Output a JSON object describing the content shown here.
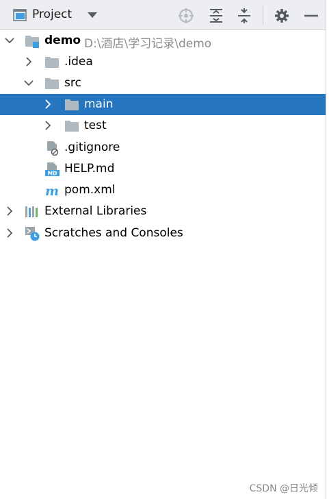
{
  "toolbar": {
    "title": "Project",
    "buttons": [
      "locate-icon",
      "expand-all-icon",
      "collapse-all-icon",
      "gear-icon",
      "minimize-icon"
    ]
  },
  "tree": {
    "root": {
      "label": "demo",
      "path": "D:\\酒店\\学习记录\\demo"
    },
    "idea": {
      "label": ".idea"
    },
    "src": {
      "label": "src"
    },
    "main": {
      "label": "main"
    },
    "test": {
      "label": "test"
    },
    "gitignore": {
      "label": ".gitignore"
    },
    "help": {
      "label": "HELP.md"
    },
    "pom": {
      "label": "pom.xml"
    },
    "libs": {
      "label": "External Libraries"
    },
    "scratches": {
      "label": "Scratches and Consoles"
    }
  },
  "colors": {
    "selection": "#2675bf",
    "folder": "#aeb9c0",
    "toolbar_bg": "#eceef1"
  },
  "watermark": "CSDN @日光倾"
}
